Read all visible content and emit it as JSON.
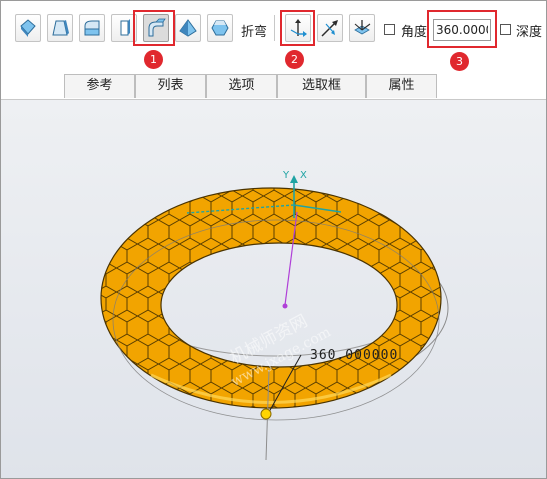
{
  "toolbar": {
    "bend_label": "折弯",
    "angle_label": "角度",
    "angle_value": "360.0000",
    "depth_label": "深度",
    "buttons": [
      {
        "icon": "shape-rhombus-icon"
      },
      {
        "icon": "shape-trapezoid-icon"
      },
      {
        "icon": "shape-quarter-cylinder-icon"
      },
      {
        "icon": "shape-slab-icon"
      },
      {
        "icon": "shape-bend-icon",
        "selected": true
      },
      {
        "icon": "shape-wedge-icon"
      },
      {
        "icon": "shape-hexagon-icon"
      }
    ],
    "axis_buttons": [
      {
        "icon": "axis-arrows-icon"
      },
      {
        "icon": "diagonal-arrow-icon"
      },
      {
        "icon": "axis-triad-icon"
      }
    ]
  },
  "callouts": [
    "1",
    "2",
    "3"
  ],
  "tabs": [
    "参考",
    "列表",
    "选项",
    "选取框",
    "属性"
  ],
  "viewport": {
    "axis_y_label": "Y",
    "axis_x_label": "X",
    "dimension_text": "360.000000",
    "watermark_line1": "机械师资网",
    "watermark_line2": "www.jxage.com",
    "colors": {
      "torus": "#f2a400",
      "accent_red": "#e0282e",
      "axis_cyan": "#1fa3a3",
      "axis_magenta": "#b040d8"
    }
  }
}
